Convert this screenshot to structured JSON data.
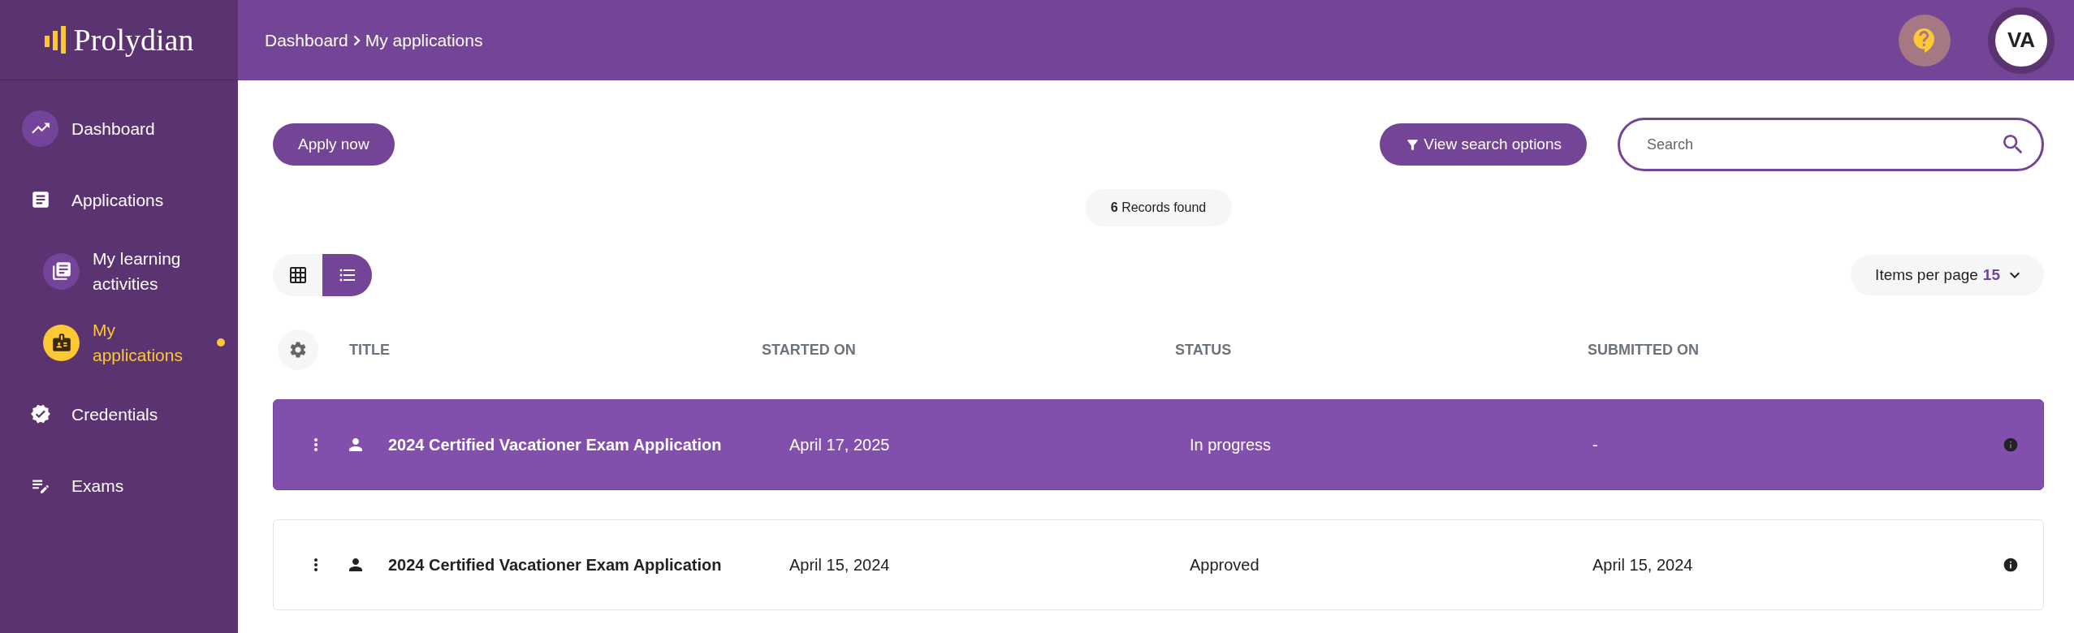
{
  "sidebar": {
    "logo": "Prolydian",
    "items": [
      {
        "kind": "trend",
        "label": "Dashboard",
        "highlighted": true,
        "selected": false
      },
      {
        "kind": "document",
        "label": "Applications",
        "highlighted": false,
        "selected": false,
        "children": [
          {
            "kind": "library",
            "label": "My learning activities",
            "highlighted": true,
            "selected": false
          },
          {
            "kind": "badge",
            "label": "My applications",
            "highlighted": true,
            "selected": true
          }
        ]
      },
      {
        "kind": "verified",
        "label": "Credentials",
        "highlighted": false,
        "selected": false
      },
      {
        "kind": "edit",
        "label": "Exams",
        "highlighted": false,
        "selected": false
      }
    ]
  },
  "header": {
    "breadcrumb": [
      "Dashboard",
      "My applications"
    ],
    "avatar": "VA"
  },
  "toolbar": {
    "apply_button": "Apply now",
    "search_options_button": "View search options",
    "search": {
      "placeholder": "Search"
    }
  },
  "records": "**6** Records found",
  "view_toggle": [
    {
      "kind": "grid",
      "selected": false
    },
    {
      "kind": "list",
      "selected": true
    }
  ],
  "items_per_page": {
    "label": "Items per page",
    "value": "15"
  },
  "table": {
    "columns": [
      "TITLE",
      "STARTED ON",
      "STATUS",
      "SUBMITTED ON"
    ],
    "rows": [
      {
        "selected": true,
        "cells": [
          "2024 Certified Vacationer Exam Application",
          "April 17, 2025",
          "In progress",
          "-"
        ]
      },
      {
        "selected": false,
        "cells": [
          "2024 Certified Vacationer Exam Application",
          "April 15, 2024",
          "Approved",
          "April 15, 2024"
        ]
      }
    ]
  }
}
